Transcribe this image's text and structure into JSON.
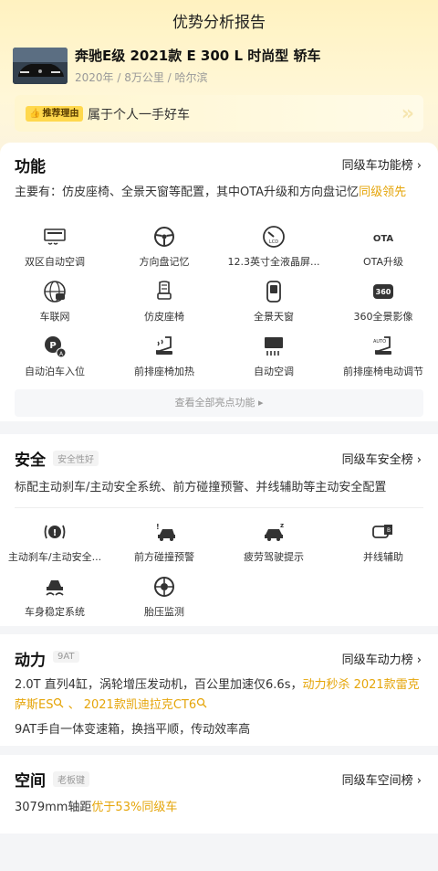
{
  "page": {
    "title": "优势分析报告"
  },
  "car": {
    "name": "奔驰E级 2021款 E 300 L 时尚型 轿车",
    "meta": "2020年 / 8万公里 / 哈尔滨"
  },
  "reason": {
    "badge": "推荐理由",
    "text": "属于个人一手好车"
  },
  "function": {
    "title": "功能",
    "rank": "同级车功能榜 ›",
    "desc_main": "主要有：仿皮座椅、全景天窗等配置，其中OTA升级和方向盘记忆",
    "desc_hl": "同级领先",
    "items": [
      {
        "label": "双区自动空调",
        "icon": "dual-zone-ac-icon"
      },
      {
        "label": "方向盘记忆",
        "icon": "steering-wheel-icon"
      },
      {
        "label": "12.3英寸全液晶屏...",
        "icon": "lcd-gauge-icon"
      },
      {
        "label": "OTA升级",
        "icon": "ota-icon"
      },
      {
        "label": "车联网",
        "icon": "connected-car-icon"
      },
      {
        "label": "仿皮座椅",
        "icon": "leather-seat-icon"
      },
      {
        "label": "全景天窗",
        "icon": "sunroof-icon"
      },
      {
        "label": "360全景影像",
        "icon": "camera-360-icon"
      },
      {
        "label": "自动泊车入位",
        "icon": "auto-parking-icon"
      },
      {
        "label": "前排座椅加热",
        "icon": "seat-heating-icon"
      },
      {
        "label": "自动空调",
        "icon": "auto-ac-icon"
      },
      {
        "label": "前排座椅电动调节",
        "icon": "power-seat-icon"
      }
    ],
    "more": "查看全部亮点功能 ▸"
  },
  "safety": {
    "title": "安全",
    "tag": "安全性好",
    "rank": "同级车安全榜 ›",
    "desc": "标配主动刹车/主动安全系统、前方碰撞预警、并线辅助等主动安全配置",
    "items": [
      {
        "label": "主动刹车/主动安全...",
        "icon": "brake-warning-icon"
      },
      {
        "label": "前方碰撞预警",
        "icon": "collision-warning-icon"
      },
      {
        "label": "疲劳驾驶提示",
        "icon": "fatigue-icon"
      },
      {
        "label": "并线辅助",
        "icon": "lane-assist-icon"
      },
      {
        "label": "车身稳定系统",
        "icon": "stability-icon"
      },
      {
        "label": "胎压监测",
        "icon": "tire-pressure-icon"
      }
    ]
  },
  "power": {
    "title": "动力",
    "tag": "9AT",
    "rank": "同级车动力榜 ›",
    "line1_a": "2.0T 直列4缸，涡轮增压发动机，百公里加速仅6.6s，",
    "line1_hl": "动力秒杀 2021款雷克萨斯ES",
    "line1_hl2": "2021款凯迪拉克CT6",
    "sep": " 、 ",
    "line2": "9AT手自一体变速箱，换挡平顺，传动效率高"
  },
  "space": {
    "title": "空间",
    "tag": "老板键",
    "rank": "同级车空间榜 ›",
    "desc_main": "3079mm轴距",
    "desc_hl": "优于53%同级车"
  }
}
